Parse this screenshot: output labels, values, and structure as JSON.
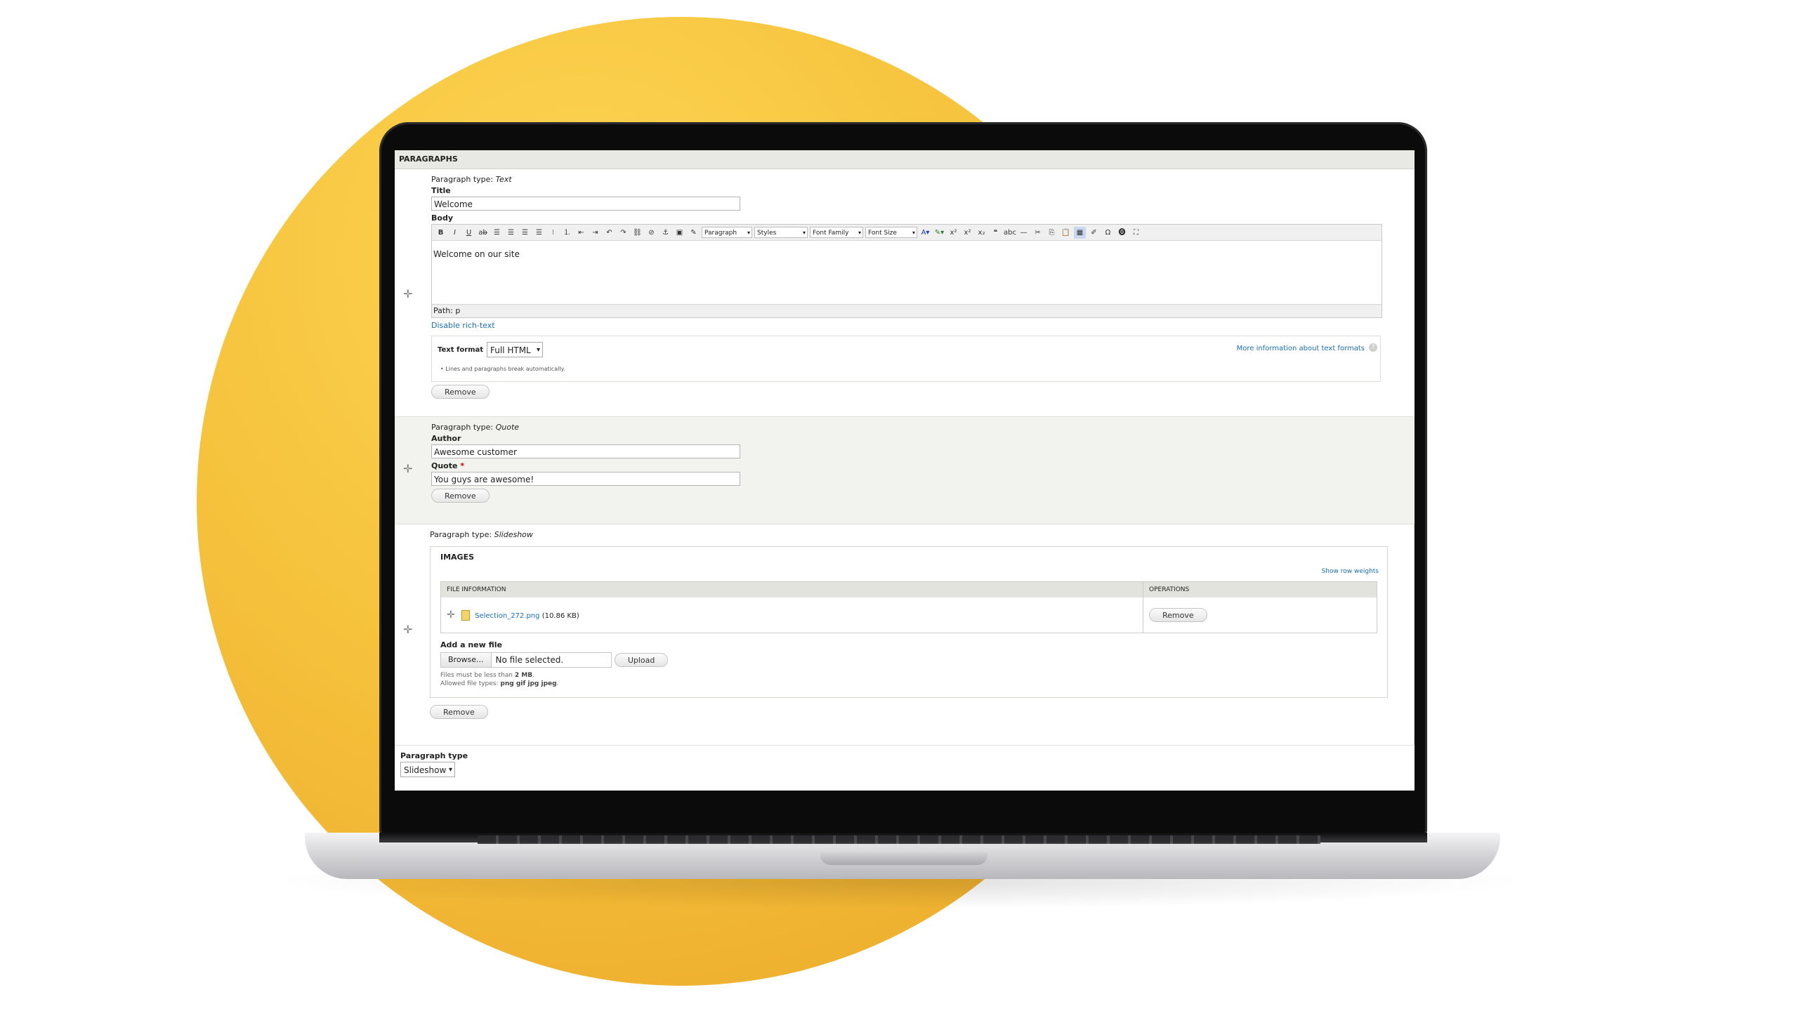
{
  "section_title": "PARAGRAPHS",
  "paragraphs": {
    "type_label": "Paragraph type:",
    "text": {
      "type_name": "Text",
      "title_label": "Title",
      "title_value": "Welcome",
      "body_label": "Body",
      "toolbar": {
        "format_select": "Paragraph",
        "styles_select": "Styles",
        "font_family_select": "Font Family",
        "font_size_select": "Font Size"
      },
      "body_content": "Welcome on our site",
      "path": "Path: p",
      "disable_rich_text": "Disable rich-text",
      "text_format_label": "Text format",
      "text_format_value": "Full HTML",
      "more_info": "More information about text formats",
      "tip": "Lines and paragraphs break automatically.",
      "remove": "Remove"
    },
    "quote": {
      "type_name": "Quote",
      "author_label": "Author",
      "author_value": "Awesome customer",
      "quote_label": "Quote",
      "required_mark": "*",
      "quote_value": "You guys are awesome!",
      "remove": "Remove"
    },
    "slideshow": {
      "type_name": "Slideshow",
      "images_title": "IMAGES",
      "show_row_weights": "Show row weights",
      "col_file_info": "FILE INFORMATION",
      "col_operations": "OPERATIONS",
      "file_name": "Selection_272.png",
      "file_size": "(10.86 KB)",
      "row_remove": "Remove",
      "add_file_label": "Add a new file",
      "browse": "Browse...",
      "no_file": "No file selected.",
      "upload": "Upload",
      "hint_size_prefix": "Files must be less than",
      "hint_size_value": "2 MB",
      "hint_types_prefix": "Allowed file types:",
      "hint_types_value": "png gif jpg jpeg",
      "remove": "Remove"
    }
  },
  "add_paragraph": {
    "label": "Paragraph type",
    "selected": "Slideshow"
  },
  "colors": {
    "accent_circle": "#f6c33d",
    "link": "#1a6fb3",
    "required": "#cc0000"
  },
  "icons": {
    "drag": "drag-handle-icon",
    "file": "image-file-icon",
    "help": "help-icon"
  }
}
